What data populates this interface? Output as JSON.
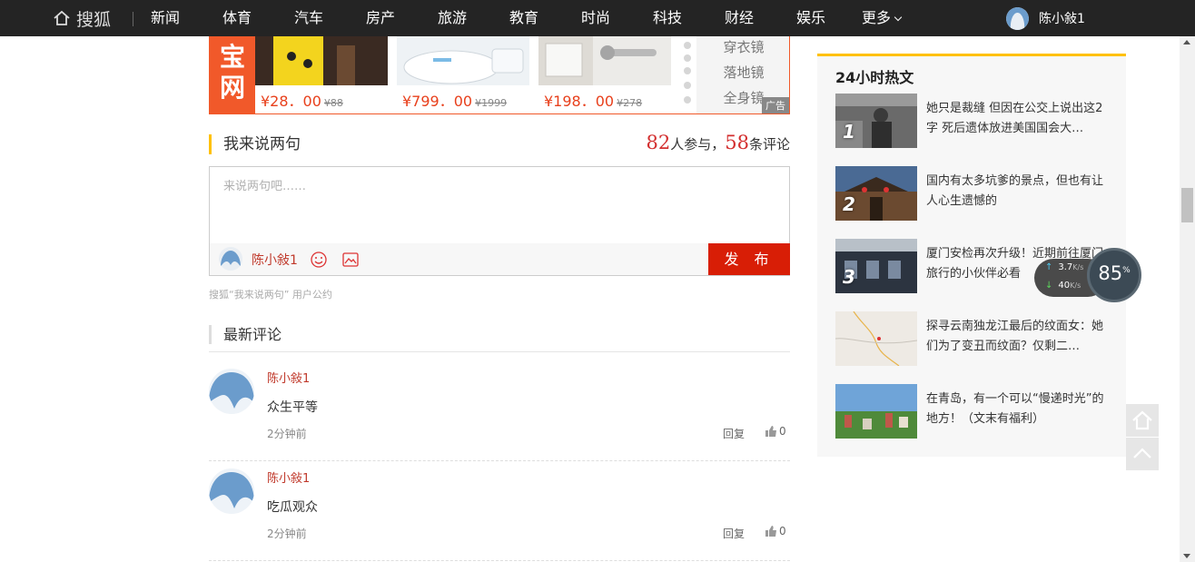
{
  "nav": {
    "logo": "搜狐",
    "items": [
      "新闻",
      "体育",
      "汽车",
      "房产",
      "旅游",
      "教育",
      "时尚",
      "科技",
      "财经",
      "娱乐"
    ],
    "more": "更多",
    "user": "陈小敍1"
  },
  "ad": {
    "logo_text": "宝网",
    "products": [
      {
        "price": "¥28．00",
        "old": "¥88"
      },
      {
        "price": "¥799．00",
        "old": "¥1999"
      },
      {
        "price": "¥198．00",
        "old": "¥278"
      }
    ],
    "menu": [
      "穿衣镜",
      "落地镜",
      "全身镜"
    ],
    "tag": "广告"
  },
  "comments_box": {
    "title": "我来说两句",
    "participants": "82",
    "participants_label": "人参与，",
    "count": "58",
    "count_label": "条评论",
    "placeholder": "来说两句吧……",
    "user": "陈小敍1",
    "publish": "发 布",
    "policy": "搜狐“我来说两句” 用户公约"
  },
  "latest": {
    "title": "最新评论",
    "items": [
      {
        "name": "陈小敍1",
        "text": "众生平等",
        "time": "2分钟前",
        "reply": "回复",
        "likes": "0"
      },
      {
        "name": "陈小敍1",
        "text": "吃瓜观众",
        "time": "2分钟前",
        "reply": "回复",
        "likes": "0"
      }
    ]
  },
  "hot": {
    "title": "24小时热文",
    "items": [
      {
        "rank": "1",
        "text": "她只是裁缝 但因在公交上说出这2字 死后遗体放进美国国会大…"
      },
      {
        "rank": "2",
        "text": "国内有太多坑爹的景点，但也有让人心生遗憾的"
      },
      {
        "rank": "3",
        "text": "厦门安检再次升级！近期前往厦门旅行的小伙伴必看"
      },
      {
        "rank": "",
        "text": "探寻云南独龙江最后的纹面女：她们为了变丑而纹面？仅剩二…"
      },
      {
        "rank": "",
        "text": "在青岛，有一个可以“慢递时光”的地方！（文末有福利）"
      }
    ]
  },
  "net_widget": {
    "up": "3.7",
    "down": "40",
    "unit": "K/s",
    "percent": "85",
    "percent_unit": "%"
  },
  "colors": {
    "topbar": "#242424",
    "accent_red": "#d81e06",
    "accent_yellow": "#ffc107",
    "ad_orange": "#f1592a"
  }
}
